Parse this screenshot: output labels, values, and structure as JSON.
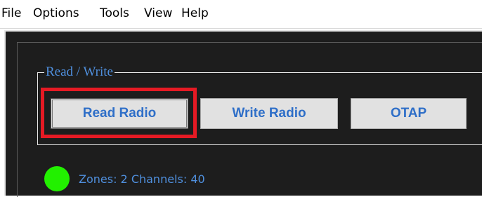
{
  "menu": {
    "items": [
      {
        "label": "File"
      },
      {
        "label": "Options"
      },
      {
        "label": "Tools"
      },
      {
        "label": "View"
      },
      {
        "label": "Help"
      }
    ]
  },
  "read_write_group": {
    "title": "Read / Write",
    "buttons": {
      "read_radio": "Read Radio",
      "write_radio": "Write Radio",
      "otap": "OTAP"
    }
  },
  "status": {
    "text": "Zones: 2 Channels: 40",
    "indicator_color": "#22f000"
  },
  "colors": {
    "accent_text": "#4f8fdd",
    "highlight": "#e61a24",
    "panel_background": "#1d1d1d"
  }
}
